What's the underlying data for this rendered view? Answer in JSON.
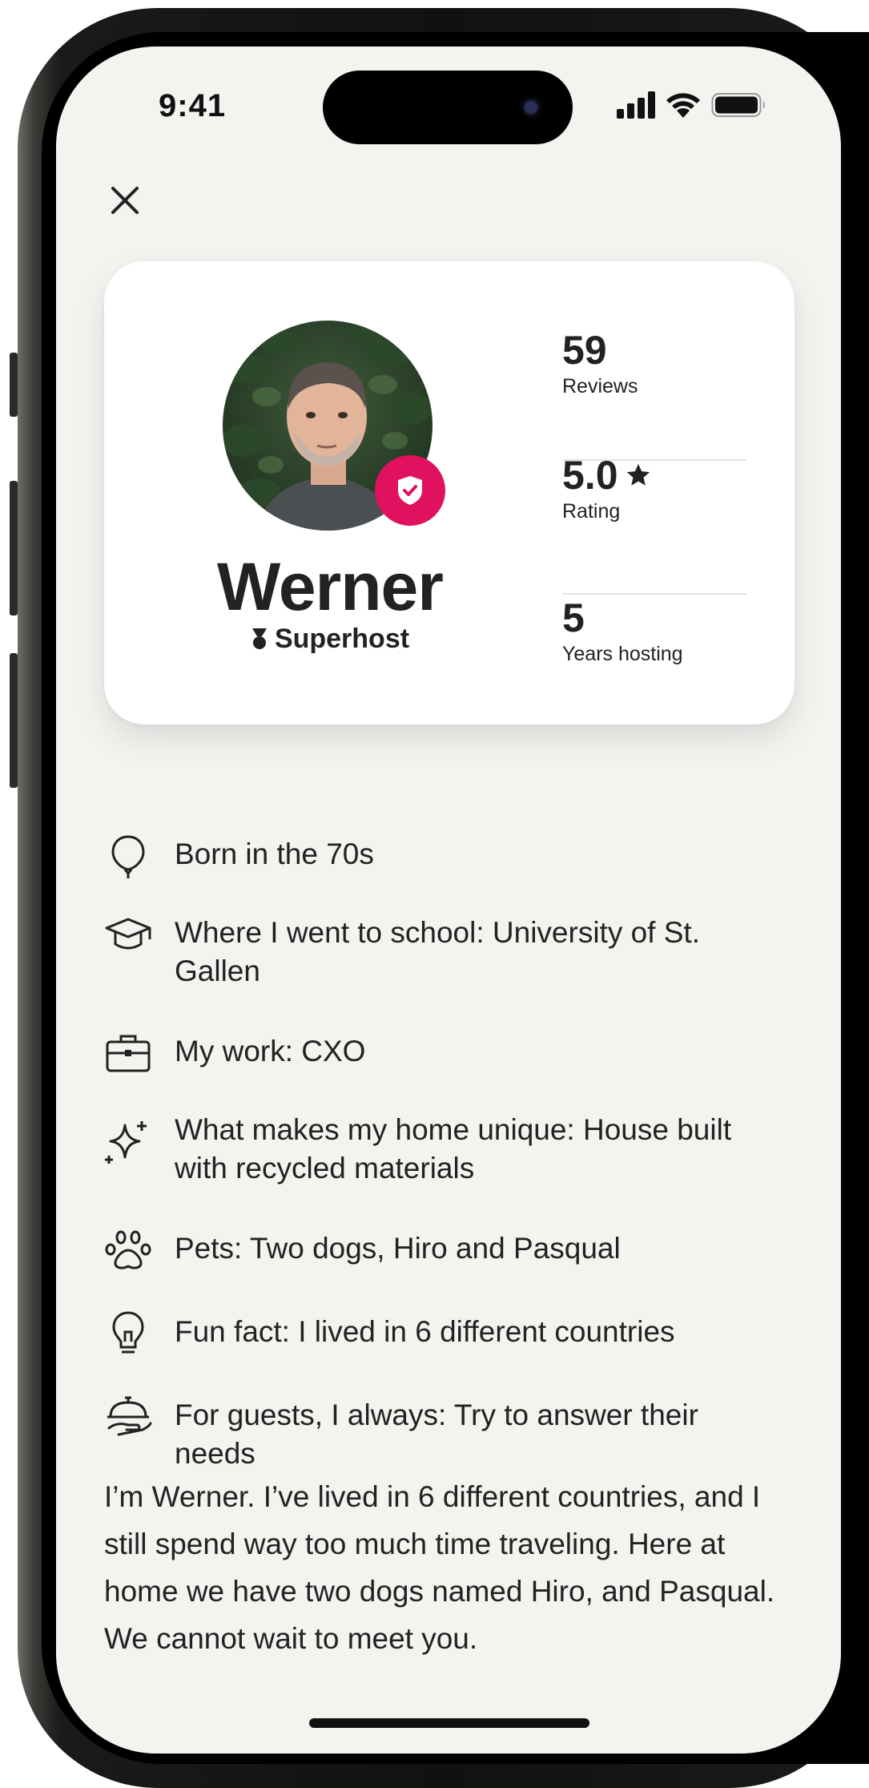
{
  "status_bar": {
    "time": "9:41"
  },
  "profile": {
    "name": "Werner",
    "badge_label": "Superhost",
    "stats": [
      {
        "value": "59",
        "label": "Reviews"
      },
      {
        "value": "5.0",
        "label": "Rating"
      },
      {
        "value": "5",
        "label": "Years hosting"
      }
    ]
  },
  "facts": [
    {
      "icon": "balloon-icon",
      "text": "Born in the 70s"
    },
    {
      "icon": "graduation-cap-icon",
      "text": "Where I went to school: University of St. Gallen"
    },
    {
      "icon": "briefcase-icon",
      "text": "My work: CXO"
    },
    {
      "icon": "sparkles-icon",
      "text": "What makes my home unique: House built with recycled materials"
    },
    {
      "icon": "paw-icon",
      "text": "Pets: Two dogs, Hiro and Pasqual"
    },
    {
      "icon": "lightbulb-icon",
      "text": "Fun fact: I lived in 6 different countries"
    },
    {
      "icon": "serving-dish-icon",
      "text": "For guests, I always: Try to answer their needs"
    }
  ],
  "about": "I’m Werner. I’ve lived in 6 different countries, and I still spend way too much time traveling. Here at home we have two dogs named Hiro, and Pasqual. We cannot wait to meet you.",
  "colors": {
    "accent": "#e0115f",
    "background": "#f4f3f0",
    "text": "#222222"
  }
}
